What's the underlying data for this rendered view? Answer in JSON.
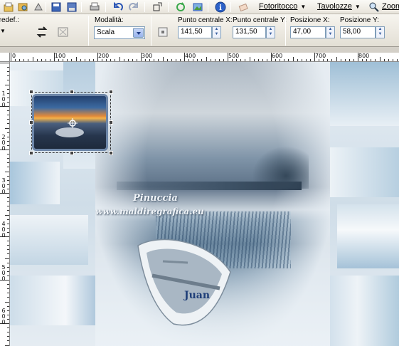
{
  "toolbar": {
    "menus": [
      {
        "label": "Fotoritocco"
      },
      {
        "label": "Tavolozze"
      },
      {
        "label": "Zoom"
      }
    ]
  },
  "options": {
    "preset_label": "Predef.:",
    "mode_label": "Modalità:",
    "mode_value": "Scala",
    "pivot_x_label": "Punto centrale X:",
    "pivot_x_value": "141,50",
    "pivot_y_label": "Punto centrale Y:",
    "pivot_y_value": "131,50",
    "pos_x_label": "Posizione X:",
    "pos_x_value": "47,00",
    "pos_y_label": "Posizione Y:",
    "pos_y_value": "58,00"
  },
  "ruler": {
    "top_labels": [
      "0",
      "100",
      "200",
      "300",
      "400",
      "500",
      "600",
      "700",
      "800"
    ],
    "left_labels": [
      "100",
      "200",
      "300",
      "400",
      "500",
      "600"
    ]
  },
  "canvas": {
    "watermark_line1": "Pinuccia",
    "watermark_line2": "www.maldiregrafica.eu",
    "boat_name": "Juan"
  }
}
